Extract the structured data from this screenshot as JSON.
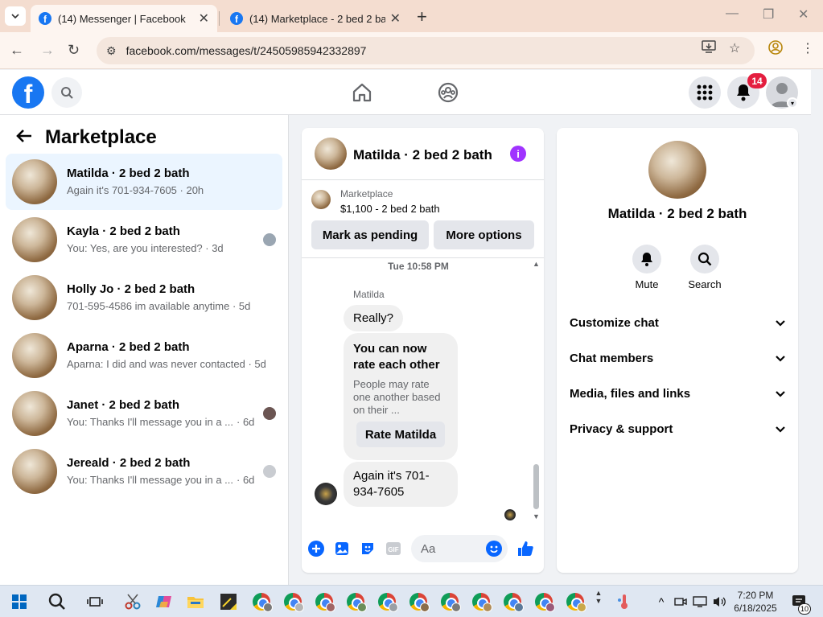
{
  "browser": {
    "tabs": [
      {
        "title": "(14) Messenger | Facebook",
        "active": true
      },
      {
        "title": "(14) Marketplace - 2 bed 2 bath",
        "active": false
      }
    ],
    "url": "facebook.com/messages/t/24505985942332897"
  },
  "fb_header": {
    "notification_count": "14"
  },
  "left_panel": {
    "title": "Marketplace",
    "conversations": [
      {
        "name": "Matilda · 2 bed 2 bath",
        "preview": "Again it's 701-934-7605 · 20h",
        "time": "",
        "selected": true
      },
      {
        "name": "Kayla · 2 bed 2 bath",
        "preview": "You: Yes, are you interested? · 3d",
        "time": "",
        "selected": false
      },
      {
        "name": "Holly Jo · 2 bed 2 bath",
        "preview": "701-595-4586 im available anytime · 5d",
        "time": "",
        "selected": false
      },
      {
        "name": "Aparna · 2 bed 2 bath",
        "preview": "Aparna: I did and was never contacted · 5d",
        "time": "",
        "selected": false
      },
      {
        "name": "Janet · 2 bed 2 bath",
        "preview": "You: Thanks I'll message you in a ...",
        "time": "· 6d",
        "selected": false
      },
      {
        "name": "Jereald · 2 bed 2 bath",
        "preview": "You: Thanks I'll message you in a ...",
        "time": "· 6d",
        "selected": false
      }
    ]
  },
  "chat": {
    "title": "Matilda · 2 bed 2 bath",
    "marketplace_label": "Marketplace",
    "listing": "$1,100 - 2 bed 2 bath",
    "btn_pending": "Mark as pending",
    "btn_more": "More options",
    "timestamp": "Tue 10:58 PM",
    "sender": "Matilda",
    "msg1": "Really?",
    "card_title": "You can now rate each other",
    "card_desc": "People may rate one another based on their ...",
    "card_button": "Rate Matilda",
    "msg_last": "Again it's 701-934-7605",
    "composer_placeholder": "Aa"
  },
  "info": {
    "name": "Matilda · 2 bed 2 bath",
    "actions": [
      {
        "label": "Mute"
      },
      {
        "label": "Search"
      }
    ],
    "sections": [
      "Customize chat",
      "Chat members",
      "Media, files and links",
      "Privacy & support"
    ]
  },
  "taskbar": {
    "time": "7:20 PM",
    "date": "6/18/2025",
    "notif_count": "10"
  },
  "colors": {
    "fb_blue": "#1877f2",
    "messenger_purple": "#a033ff",
    "selected_row": "#ebf5ff",
    "badge_red": "#e41e3f"
  }
}
